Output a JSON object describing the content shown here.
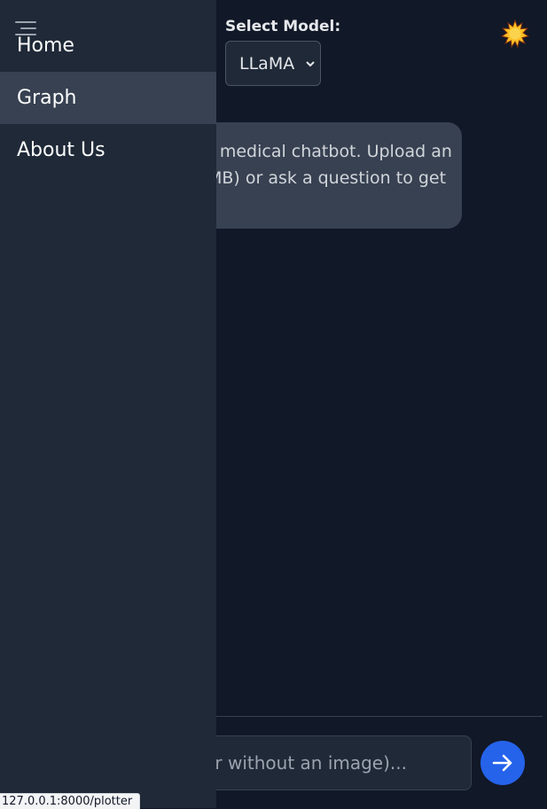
{
  "header": {
    "model_label": "Select Model:",
    "model_selected": "LLaMA",
    "theme_icon": "sun-emoji-icon"
  },
  "chat": {
    "bot_message_lines": [
      "r medical chatbot. Upload an",
      "MB) or ask a question to get"
    ]
  },
  "composer": {
    "placeholder": "ch or without an image)...",
    "send_icon": "arrow-right-icon"
  },
  "sidebar": {
    "menu_icon": "hamburger-icon",
    "items": [
      {
        "label": "Home",
        "active": false
      },
      {
        "label": "Graph",
        "active": true
      },
      {
        "label": "About Us",
        "active": false
      }
    ]
  },
  "status_bar": {
    "url": "127.0.0.1:8000/plotter"
  },
  "colors": {
    "background": "#111827",
    "sidebar": "#1f2937",
    "active_item": "#374151",
    "send_button": "#2563eb"
  }
}
